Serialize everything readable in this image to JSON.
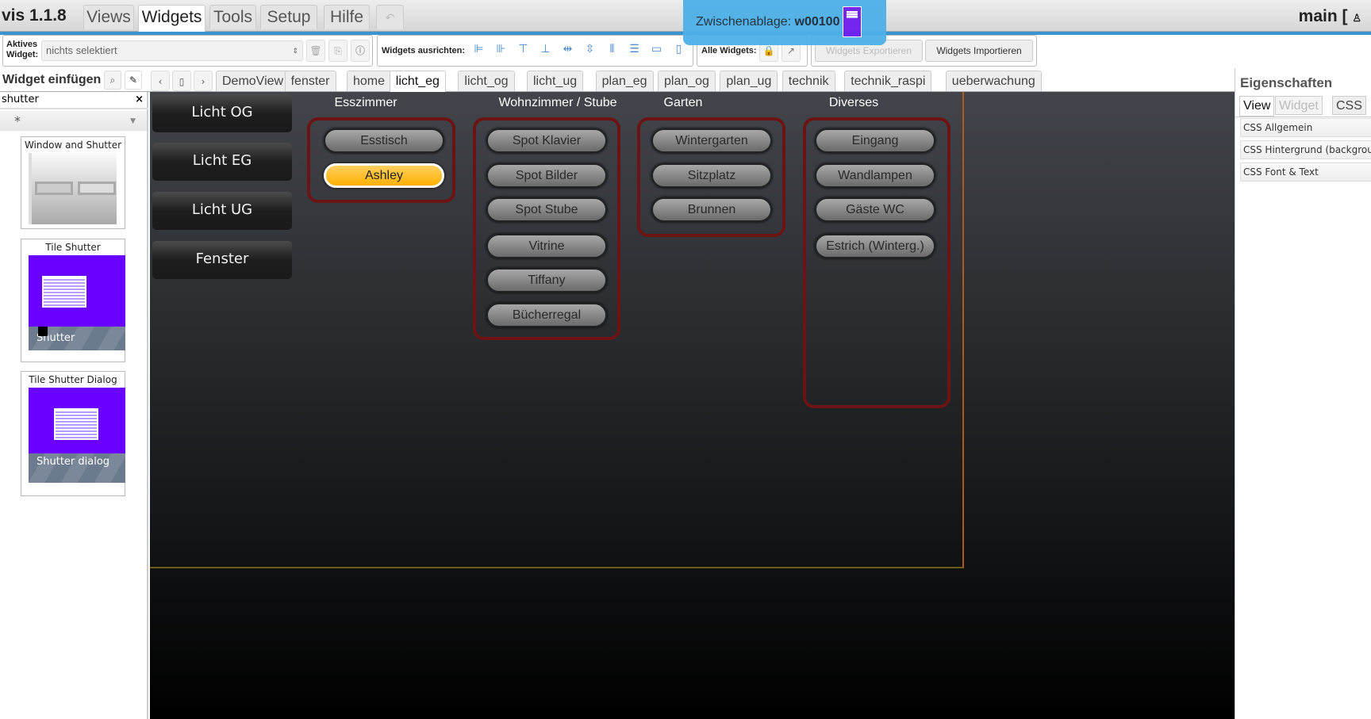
{
  "app": {
    "title": "vis 1.1.8",
    "project": "main [",
    "undo_icon": "undo-icon"
  },
  "menu": [
    "Views",
    "Widgets",
    "Tools",
    "Setup",
    "Hilfe"
  ],
  "clipboard": {
    "label": "Zwischenablage:",
    "value": "w00100",
    "color": "#6f1df0"
  },
  "toolbar": {
    "active_widget_label_1": "Aktives",
    "active_widget_label_2": "Widget:",
    "active_widget_value": "nichts selektiert",
    "align_label": "Widgets ausrichten:",
    "all_widgets_label": "Alle Widgets:",
    "export_label": "Widgets Exportieren",
    "import_label": "Widgets Importieren"
  },
  "left": {
    "title": "Widget einfügen",
    "filter": "shutter",
    "set_filter": "*",
    "widgets": [
      {
        "title": "Window and Shutter"
      },
      {
        "title": "Tile Shutter",
        "caption": "Shutter"
      },
      {
        "title": "Tile Shutter Dialog",
        "caption": "Shutter dialog"
      }
    ]
  },
  "view_tabs": [
    "DemoView",
    "fenster",
    "home",
    "licht_eg",
    "licht_og",
    "licht_ug",
    "plan_eg",
    "plan_og",
    "plan_ug",
    "technik",
    "technik_raspi",
    "ueberwachung"
  ],
  "active_view": "licht_eg",
  "nav_buttons": [
    "Licht OG",
    "Licht EG",
    "Licht UG",
    "Fenster"
  ],
  "groups": [
    {
      "title": "Esszimmer",
      "buttons": [
        "Esstisch",
        "Ashley"
      ],
      "active": "Ashley"
    },
    {
      "title": "Wohnzimmer / Stube",
      "buttons": [
        "Spot Klavier",
        "Spot Bilder",
        "Spot Stube",
        "Vitrine",
        "Tiffany",
        "Bücherregal"
      ]
    },
    {
      "title": "Garten",
      "buttons": [
        "Wintergarten",
        "Sitzplatz",
        "Brunnen"
      ]
    },
    {
      "title": "Diverses",
      "buttons": [
        "Eingang",
        "Wandlampen",
        "Gäste WC",
        "Estrich (Winterg.)"
      ]
    }
  ],
  "right": {
    "title": "Eigenschaften",
    "tabs": [
      "View",
      "Widget",
      "CSS"
    ],
    "sections": [
      "CSS Allgemein",
      "CSS Hintergrund (background)",
      "CSS Font & Text"
    ]
  }
}
